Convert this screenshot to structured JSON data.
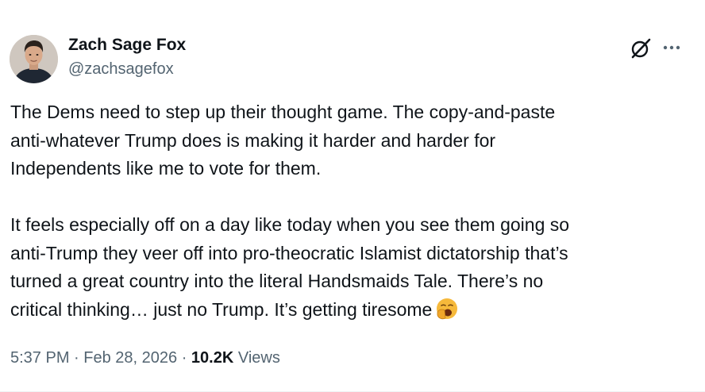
{
  "author": {
    "name": "Zach Sage Fox",
    "handle": "@zachsagefox"
  },
  "header_icons": [
    "grok-icon",
    "more-options-icon"
  ],
  "post": {
    "paragraphs": [
      {
        "lines": [
          "The Dems need to step up their thought game. The copy-and-paste",
          "anti-whatever Trump does is making it harder and harder for",
          "Independents like me to vote for them."
        ]
      },
      {
        "lines": [
          "It feels especially off on a day like today when you see them going so",
          "anti-Trump they veer off into pro-theocratic Islamist dictatorship that’s",
          "turned a great country into the literal Handsmaids Tale. There’s no",
          "critical thinking… just no Trump. It’s getting tiresome"
        ],
        "trailing_emoji": "yawning-face-emoji"
      }
    ]
  },
  "meta": {
    "time": "5:37 PM",
    "separator": " · ",
    "date": "Feb 28, 2026",
    "views_count": "10.2K",
    "views_label": " Views"
  },
  "colors": {
    "text_primary": "#0f1419",
    "text_secondary": "#536471",
    "divider": "#eff3f4"
  }
}
